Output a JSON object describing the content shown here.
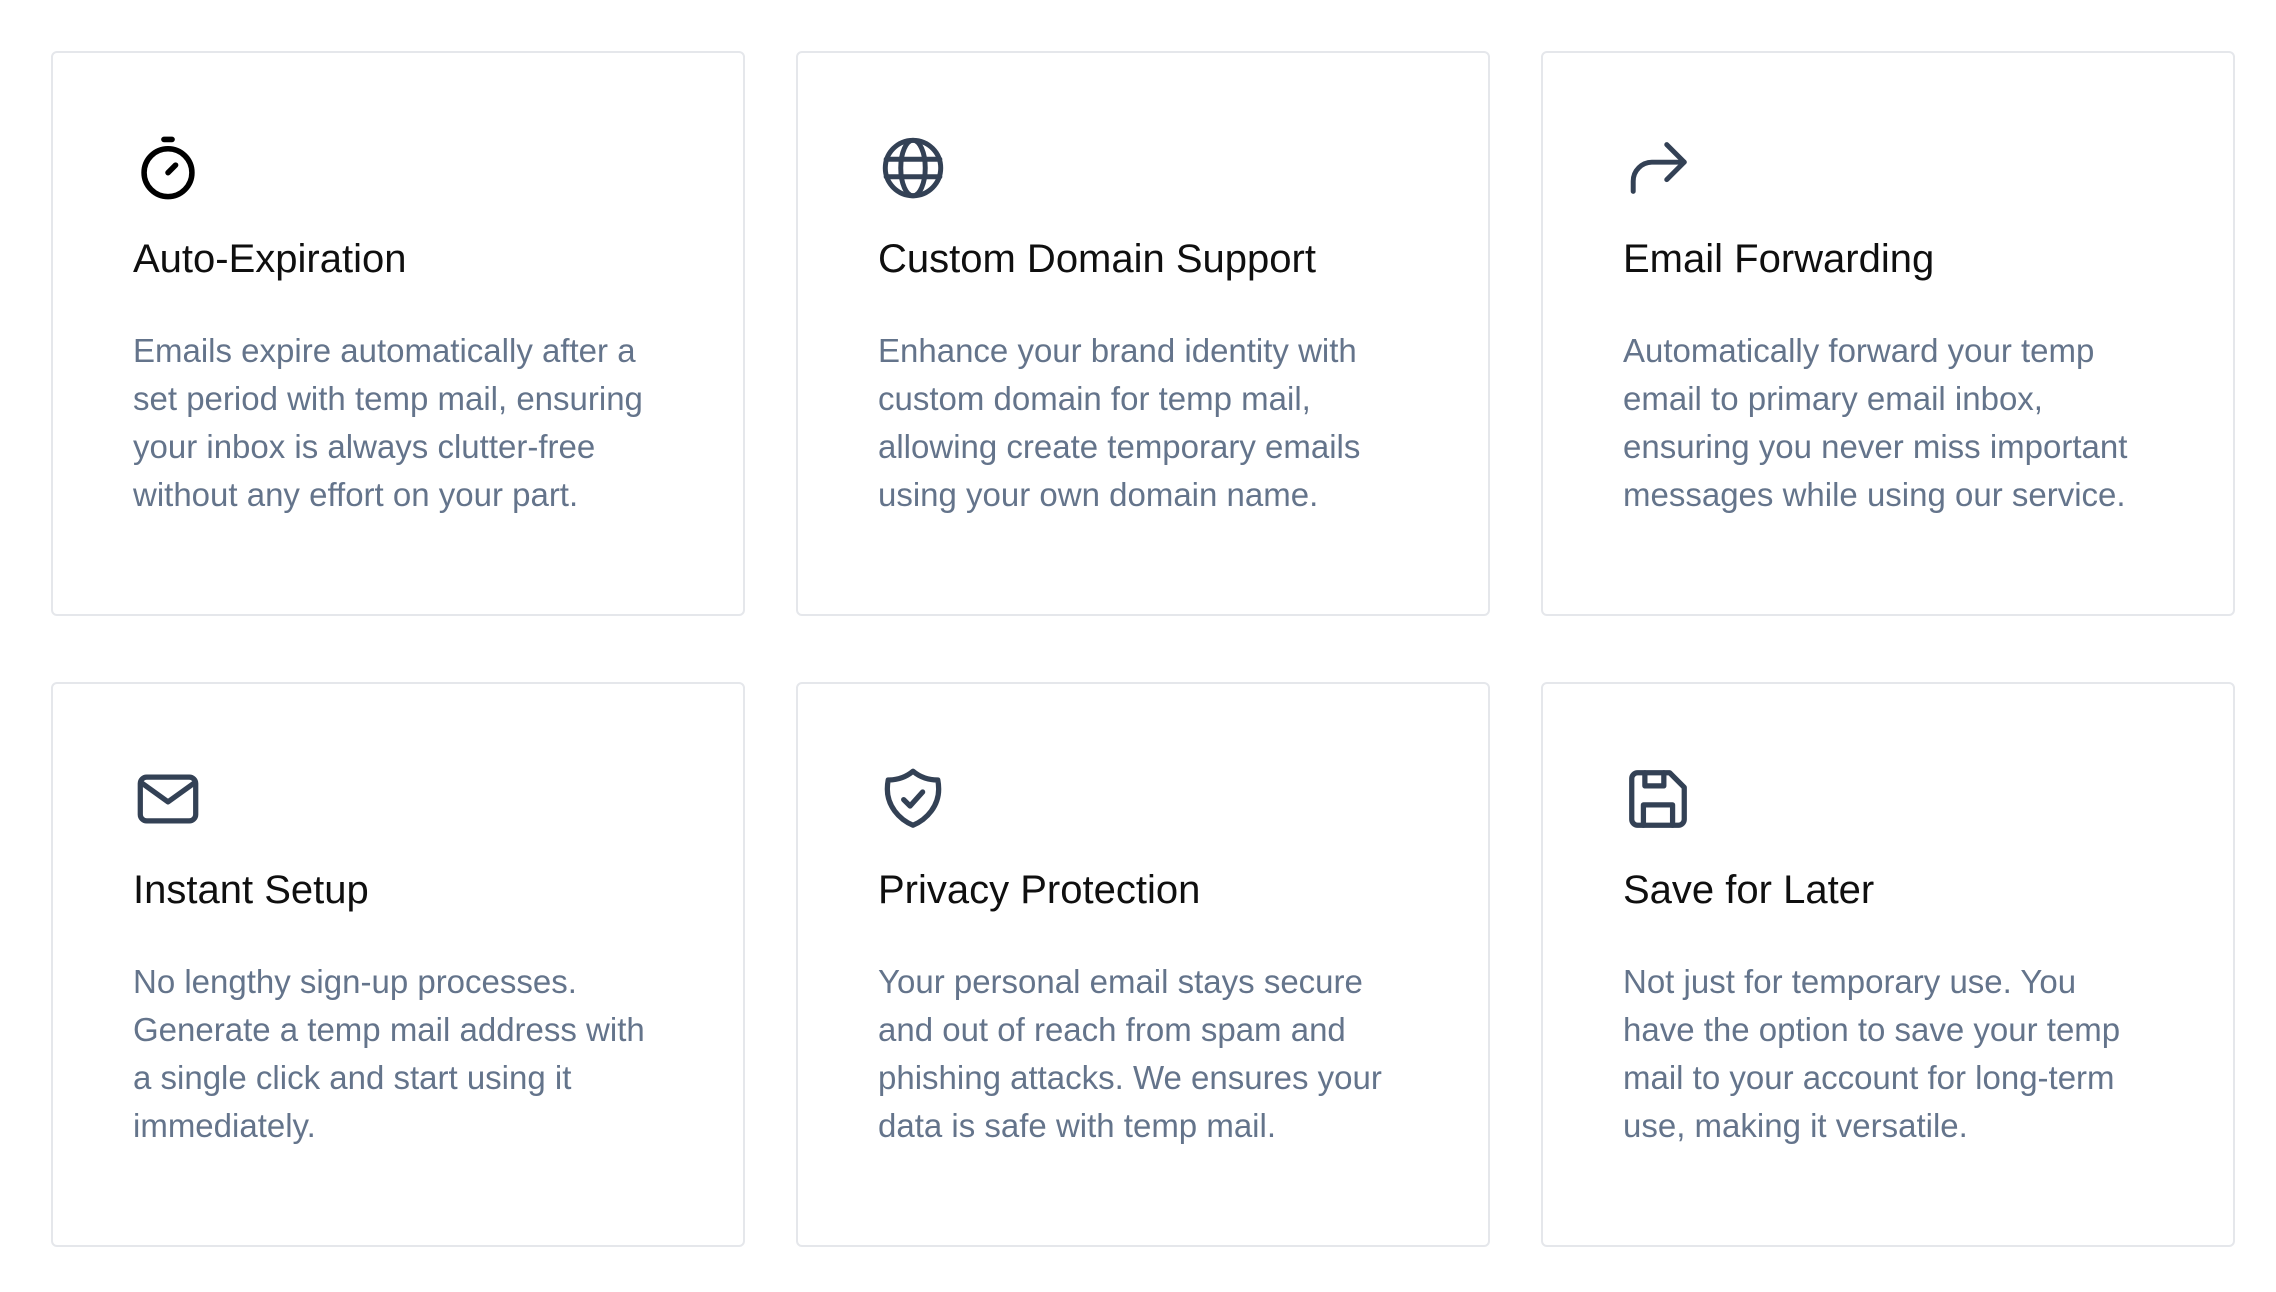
{
  "features": [
    {
      "icon": "stopwatch-icon",
      "title": "Auto-Expiration",
      "description": "Emails expire automatically after a set period with temp mail, ensuring your inbox is always clutter-free without any effort on your part."
    },
    {
      "icon": "globe-icon",
      "title": "Custom Domain Support",
      "description": "Enhance your brand identity with custom domain for temp mail, allowing create temporary emails using your own domain name."
    },
    {
      "icon": "forward-arrow-icon",
      "title": "Email Forwarding",
      "description": "Automatically forward your temp email to primary email inbox, ensuring you never miss important messages while using our service."
    },
    {
      "icon": "envelope-icon",
      "title": "Instant Setup",
      "description": "No lengthy sign-up processes. Generate a temp mail address with a single click and start using it immediately."
    },
    {
      "icon": "shield-check-icon",
      "title": "Privacy Protection",
      "description": "Your personal email stays secure and out of reach from spam and phishing attacks. We ensures your data is safe with temp mail."
    },
    {
      "icon": "floppy-disk-icon",
      "title": "Save for Later",
      "description": "Not just for temporary use. You have the option to save your temp mail to your account for long-term use, making it versatile."
    }
  ],
  "colors": {
    "title": "#0f0f0f",
    "description": "#64748b",
    "icon": "#1e293b",
    "card_border": "#e5e7eb"
  }
}
